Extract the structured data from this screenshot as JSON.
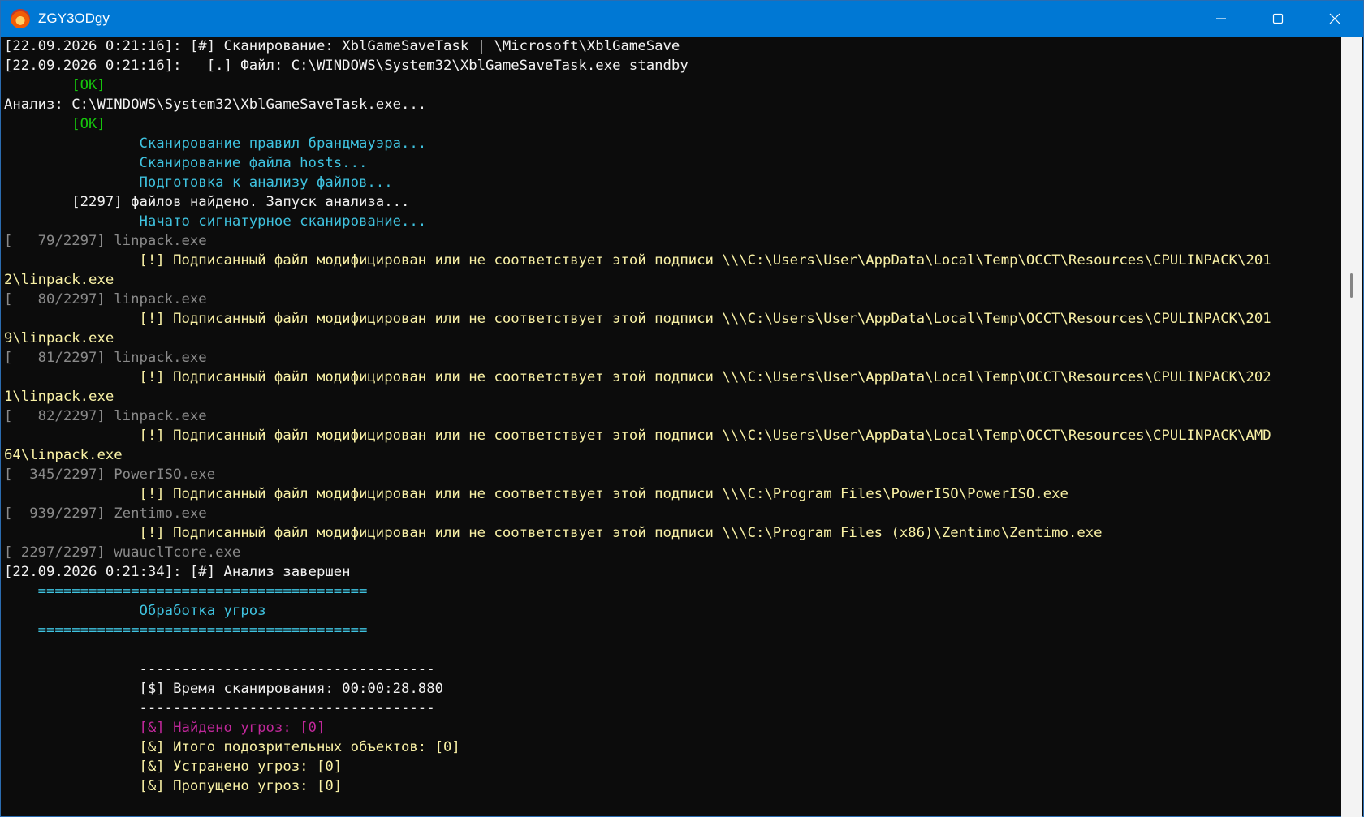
{
  "window": {
    "title": "ZGY3ODgy",
    "icon": "app-flame-icon",
    "accent": "#0078d4",
    "controls": [
      "minimize-icon",
      "maximize-icon",
      "close-icon"
    ]
  },
  "console": {
    "background": "#0c0c0c",
    "lines": [
      {
        "text": "[22.09.2026 0:21:16]: [#] Сканирование: XblGameSaveTask | \\Microsoft\\XblGameSave",
        "color": "white"
      },
      {
        "text": "[22.09.2026 0:21:16]:   [.] Файл: C:\\WINDOWS\\System32\\XblGameSaveTask.exe standby",
        "color": "white"
      },
      {
        "text": "        [OK]",
        "color": "green"
      },
      {
        "text": "Анализ: C:\\WINDOWS\\System32\\XblGameSaveTask.exe...",
        "color": "white"
      },
      {
        "text": "        [OK]",
        "color": "green"
      },
      {
        "text": "                Сканирование правил брандмауэра...",
        "color": "cyan"
      },
      {
        "text": "                Сканирование файла hosts...",
        "color": "cyan"
      },
      {
        "text": "                Подготовка к анализу файлов...",
        "color": "cyan"
      },
      {
        "text": "        [2297] файлов найдено. Запуск анализа...",
        "color": "white"
      },
      {
        "text": "                Начато сигнатурное сканирование...",
        "color": "cyan"
      },
      {
        "text": "[   79/2297] linpack.exe",
        "color": "gray"
      },
      {
        "text": "                [!] Подписанный файл модифицирован или не соответствует этой подписи \\\\\\C:\\Users\\User\\AppData\\Local\\Temp\\OCCT\\Resources\\CPULINPACK\\201",
        "color": "yellow"
      },
      {
        "text": "2\\linpack.exe",
        "color": "yellow"
      },
      {
        "text": "[   80/2297] linpack.exe",
        "color": "gray"
      },
      {
        "text": "                [!] Подписанный файл модифицирован или не соответствует этой подписи \\\\\\C:\\Users\\User\\AppData\\Local\\Temp\\OCCT\\Resources\\CPULINPACK\\201",
        "color": "yellow"
      },
      {
        "text": "9\\linpack.exe",
        "color": "yellow"
      },
      {
        "text": "[   81/2297] linpack.exe",
        "color": "gray"
      },
      {
        "text": "                [!] Подписанный файл модифицирован или не соответствует этой подписи \\\\\\C:\\Users\\User\\AppData\\Local\\Temp\\OCCT\\Resources\\CPULINPACK\\202",
        "color": "yellow"
      },
      {
        "text": "1\\linpack.exe",
        "color": "yellow"
      },
      {
        "text": "[   82/2297] linpack.exe",
        "color": "gray"
      },
      {
        "text": "                [!] Подписанный файл модифицирован или не соответствует этой подписи \\\\\\C:\\Users\\User\\AppData\\Local\\Temp\\OCCT\\Resources\\CPULINPACK\\AMD",
        "color": "yellow"
      },
      {
        "text": "64\\linpack.exe",
        "color": "yellow"
      },
      {
        "text": "[  345/2297] PowerISO.exe",
        "color": "gray"
      },
      {
        "text": "                [!] Подписанный файл модифицирован или не соответствует этой подписи \\\\\\C:\\Program Files\\PowerISO\\PowerISO.exe",
        "color": "yellow"
      },
      {
        "text": "[  939/2297] Zentimo.exe",
        "color": "gray"
      },
      {
        "text": "                [!] Подписанный файл модифицирован или не соответствует этой подписи \\\\\\C:\\Program Files (x86)\\Zentimo\\Zentimo.exe",
        "color": "yellow"
      },
      {
        "text": "[ 2297/2297] wuauclTcore.exe",
        "color": "gray"
      },
      {
        "text": "[22.09.2026 0:21:34]: [#] Анализ завершен",
        "color": "white"
      },
      {
        "text": "    =======================================",
        "color": "cyan"
      },
      {
        "text": "                Обработка угроз",
        "color": "cyan"
      },
      {
        "text": "    =======================================",
        "color": "cyan"
      },
      {
        "text": "",
        "color": "white"
      },
      {
        "text": "                -----------------------------------",
        "color": "white"
      },
      {
        "text": "                [$] Время сканирования: 00:00:28.880",
        "color": "white"
      },
      {
        "text": "                -----------------------------------",
        "color": "white"
      },
      {
        "text": "                [&] Найдено угроз: [0]",
        "color": "magenta"
      },
      {
        "text": "                [&] Итого подозрительных объектов: [0]",
        "color": "yellow"
      },
      {
        "text": "                [&] Устранено угроз: [0]",
        "color": "yellow"
      },
      {
        "text": "                [&] Пропущено угроз: [0]",
        "color": "yellow"
      }
    ]
  }
}
